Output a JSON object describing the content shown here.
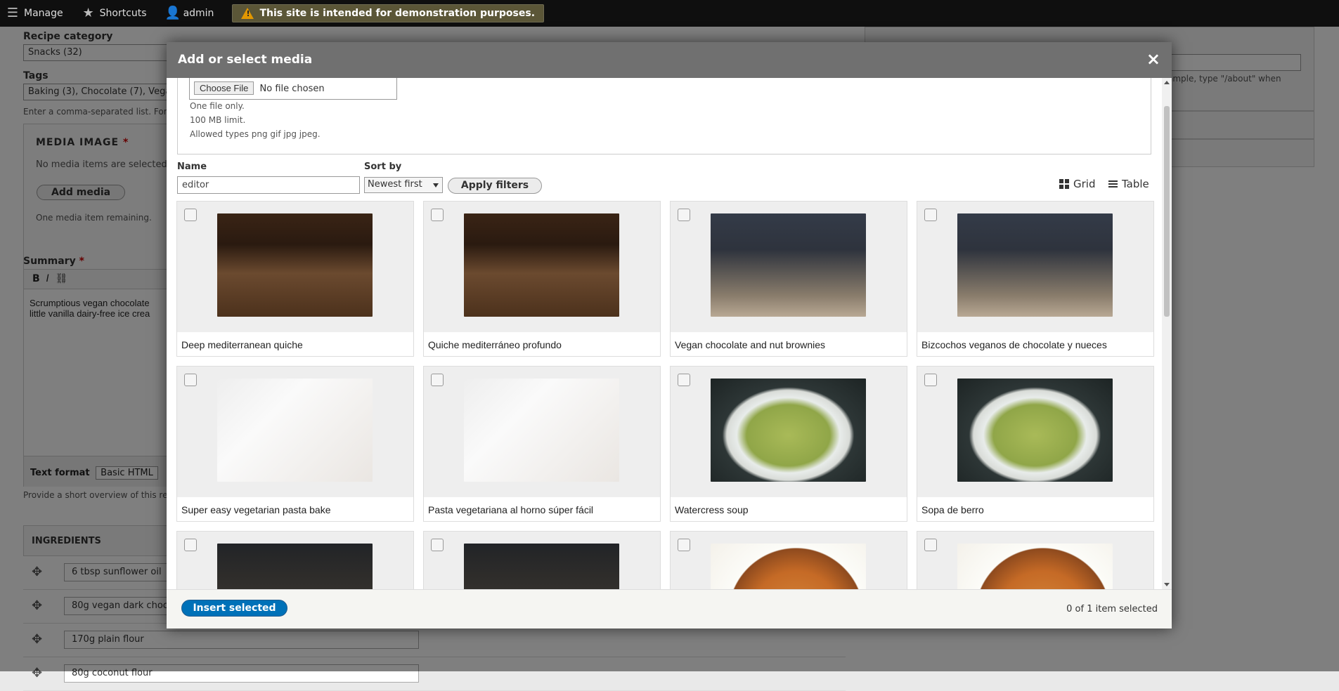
{
  "toolbar": {
    "manage": "Manage",
    "shortcuts": "Shortcuts",
    "user": "admin",
    "warning": "This site is intended for demonstration purposes."
  },
  "background": {
    "recipe_category_label": "Recipe category",
    "recipe_category_value": "Snacks (32)",
    "tags_label": "Tags",
    "tags_value": "Baking (3), Chocolate (7), Vegan",
    "tags_desc": "Enter a comma-separated list. For",
    "media_image_label": "MEDIA IMAGE",
    "required_mark": "*",
    "no_media_text": "No media items are selected.",
    "add_media_button": "Add media",
    "remaining_text": "One media item remaining.",
    "summary_label": "Summary",
    "summary_text_1": "Scrumptious vegan chocolate",
    "summary_text_2": "little vanilla dairy-free ice crea",
    "text_format_label": "Text format",
    "text_format_value": "Basic HTML",
    "summary_desc": "Provide a short overview of this re",
    "ingredients_label": "INGREDIENTS",
    "ingredients": [
      "6 tbsp sunflower oil",
      "80g vegan dark choco",
      "170g plain flour",
      "80g coconut flour"
    ],
    "right_hint": "ample, type \"/about\" when"
  },
  "dialog": {
    "title": "Add or select media",
    "close": "×",
    "choose_file": "Choose File",
    "no_file": "No file chosen",
    "upload_notes": [
      "One file only.",
      "100 MB limit.",
      "Allowed types png gif jpg jpeg."
    ],
    "name_label": "Name",
    "name_value": "editor",
    "sort_label": "Sort by",
    "sort_value": "Newest first",
    "apply_button": "Apply filters",
    "grid_label": "Grid",
    "table_label": "Table",
    "media_items": [
      {
        "title": "Deep mediterranean quiche",
        "art": "quiche"
      },
      {
        "title": "Quiche mediterráneo profundo",
        "art": "quiche"
      },
      {
        "title": "Vegan chocolate and nut brownies",
        "art": "brownie"
      },
      {
        "title": "Bizcochos veganos de chocolate y nueces",
        "art": "brownie"
      },
      {
        "title": "Super easy vegetarian pasta bake",
        "art": "pasta"
      },
      {
        "title": "Pasta vegetariana al horno súper fácil",
        "art": "pasta"
      },
      {
        "title": "Watercress soup",
        "art": "soup"
      },
      {
        "title": "Sopa de berro",
        "art": "soup"
      },
      {
        "title": "",
        "art": "cake"
      },
      {
        "title": "",
        "art": "cake"
      },
      {
        "title": "",
        "art": "pizza"
      },
      {
        "title": "",
        "art": "pizza"
      }
    ],
    "insert_button": "Insert selected",
    "selected_count": "0 of 1 item selected"
  },
  "colors": {
    "primary_button": "#0071b8",
    "dialog_title_bg": "#707070",
    "toolbar_bg": "#0f0f0f",
    "warning_icon": "#e29700"
  }
}
